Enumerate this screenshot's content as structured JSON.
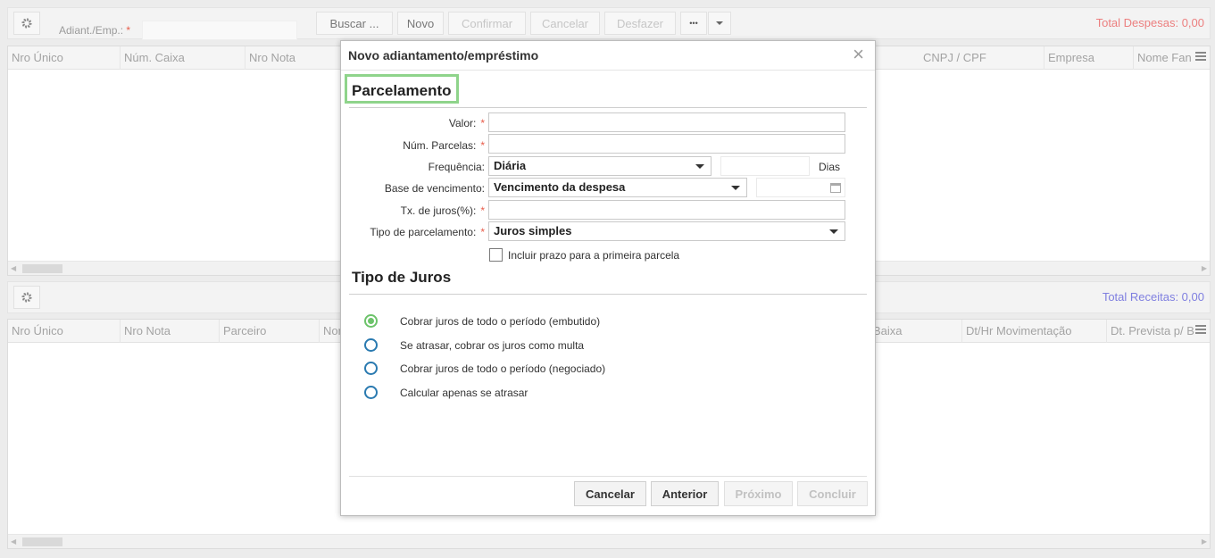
{
  "toolbar": {
    "adiant_label": "Adiant./Emp.:",
    "required_mark": "*",
    "buttons": {
      "buscar": "Buscar ...",
      "novo": "Novo",
      "confirmar": "Confirmar",
      "cancelar": "Cancelar",
      "desfazer": "Desfazer",
      "more": "•••"
    },
    "total_despesas": "Total Despesas: 0,00"
  },
  "grid_top": {
    "columns_left": [
      "Nro Único",
      "Núm. Caixa",
      "Nro Nota"
    ],
    "columns_right": [
      "CNPJ / CPF",
      "Empresa",
      "Nome Fan"
    ]
  },
  "mid_toolbar": {
    "total_receitas": "Total Receitas: 0,00"
  },
  "grid_bottom": {
    "columns_left": [
      "Nro Único",
      "Nro Nota",
      "Parceiro",
      "Nor"
    ],
    "columns_right": [
      "Baixa",
      "Dt/Hr Movimentação",
      "Dt. Prevista p/ B"
    ]
  },
  "modal": {
    "title": "Novo adiantamento/empréstimo",
    "close": "×",
    "section_parcelamento": "Parcelamento",
    "fields": {
      "valor_label": "Valor:",
      "num_parcelas_label": "Núm. Parcelas:",
      "frequencia_label": "Frequência:",
      "frequencia_value": "Diária",
      "dias_label": "Dias",
      "base_venc_label": "Base de vencimento:",
      "base_venc_value": "Vencimento da despesa",
      "tx_juros_label": "Tx. de juros(%):",
      "tipo_parc_label": "Tipo de parcelamento:",
      "tipo_parc_value": "Juros simples",
      "incluir_prazo_label": "Incluir prazo para a primeira parcela",
      "required_mark": "*"
    },
    "section_tipo_juros": "Tipo de Juros",
    "tipo_juros_options": [
      {
        "label": "Cobrar juros de todo o período (embutido)",
        "selected": true
      },
      {
        "label": "Se atrasar, cobrar os juros como multa",
        "selected": false
      },
      {
        "label": "Cobrar juros de todo o período (negociado)",
        "selected": false
      },
      {
        "label": "Calcular apenas se atrasar",
        "selected": false
      }
    ],
    "buttons": {
      "cancelar": "Cancelar",
      "anterior": "Anterior",
      "proximo": "Próximo",
      "concluir": "Concluir"
    }
  },
  "colors": {
    "total_despesas": "#ec7f7f",
    "total_receitas": "#7f7fe0",
    "section_highlight": "#8fd48b",
    "radio_selected": "#6cc36a",
    "radio_border": "#2a7ab0",
    "required": "#e85c4a"
  }
}
